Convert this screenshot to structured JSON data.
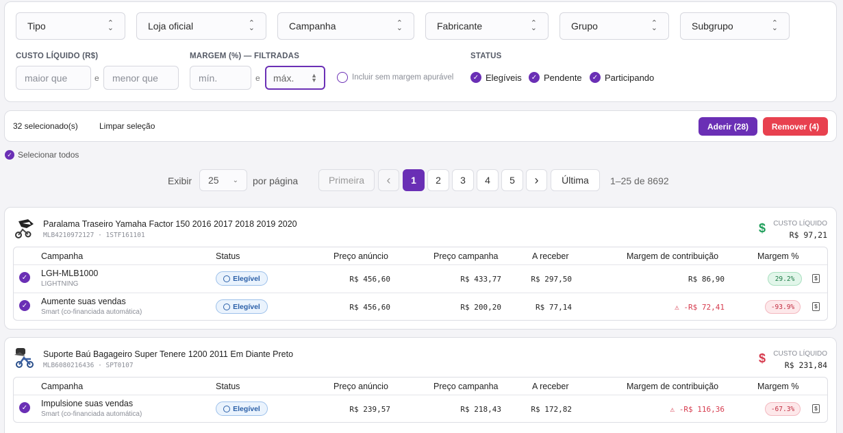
{
  "filters": {
    "selects": [
      "Tipo",
      "Loja oficial",
      "Campanha",
      "Fabricante",
      "Grupo",
      "Subgrupo"
    ],
    "custo_label": "CUSTO LÍQUIDO (R$)",
    "custo_min_placeholder": "maior que",
    "custo_max_placeholder": "menor que",
    "and_word": "e",
    "margem_label": "MARGEM (%) — FILTRADAS",
    "margem_min_placeholder": "mín.",
    "margem_max_placeholder": "máx.",
    "include_label": "Incluir sem margem apurável",
    "status_label": "STATUS",
    "status_options": [
      "Elegíveis",
      "Pendente",
      "Participando"
    ]
  },
  "selection": {
    "count_text": "32 selecionado(s)",
    "clear_label": "Limpar seleção",
    "adherir_label": "Aderir (28)",
    "remover_label": "Remover (4)",
    "select_all_label": "Selecionar todos"
  },
  "pagination": {
    "show_label": "Exibir",
    "per_page_value": "25",
    "per_page_label": "por página",
    "first_label": "Primeira",
    "prev_glyph": "‹",
    "pages": [
      "1",
      "2",
      "3",
      "4",
      "5"
    ],
    "current_page": "1",
    "next_glyph": "›",
    "last_label": "Última",
    "range_text": "1–25 de 8692"
  },
  "table_headers": [
    "Campanha",
    "Status",
    "Preço anúncio",
    "Preço campanha",
    "A receber",
    "Margem de contribuição",
    "Margem %"
  ],
  "products": [
    {
      "title": "Paralama Traseiro Yamaha Factor 150 2016 2017 2018 2019 2020",
      "sub": "MLB4210972127 · 1STF161101",
      "cost_label": "CUSTO LÍQUIDO",
      "cost_value": "R$ 97,21",
      "cost_color": "#1e9e5a",
      "rows": [
        {
          "campaign": "LGH-MLB1000",
          "sub": "LIGHTNING",
          "status": "Elegível",
          "preco_anuncio": "R$ 456,60",
          "preco_campanha": "R$ 433,77",
          "a_receber": "R$ 297,50",
          "margem_contrib": "R$ 86,90",
          "margem_pct": "29.2%",
          "negative": false
        },
        {
          "campaign": "Aumente suas vendas",
          "sub": "Smart (co-financiada automática)",
          "status": "Elegível",
          "preco_anuncio": "R$ 456,60",
          "preco_campanha": "R$ 200,20",
          "a_receber": "R$ 77,14",
          "margem_contrib": "-R$ 72,41",
          "margem_pct": "-93.9%",
          "negative": true
        }
      ]
    },
    {
      "title": "Suporte Baú Bagageiro Super Tenere 1200 2011 Em Diante Preto",
      "sub": "MLB6080216436 · SPT0107",
      "cost_label": "CUSTO LÍQUIDO",
      "cost_value": "R$ 231,84",
      "cost_color": "#d63a4d",
      "rows": [
        {
          "campaign": "Impulsione suas vendas",
          "sub": "Smart (co-financiada automática)",
          "status": "Elegível",
          "preco_anuncio": "R$ 239,57",
          "preco_campanha": "R$ 218,43",
          "a_receber": "R$ 172,82",
          "margem_contrib": "-R$ 116,36",
          "margem_pct": "-67.3%",
          "negative": true
        }
      ]
    }
  ],
  "icons": {
    "dollar": "dollar-icon",
    "warning": "warning-icon",
    "receipt": "receipt-icon",
    "check": "check-icon"
  },
  "colors": {
    "accent": "#6a2fb5",
    "danger": "#e8414f",
    "positive": "#1e9e5a"
  }
}
